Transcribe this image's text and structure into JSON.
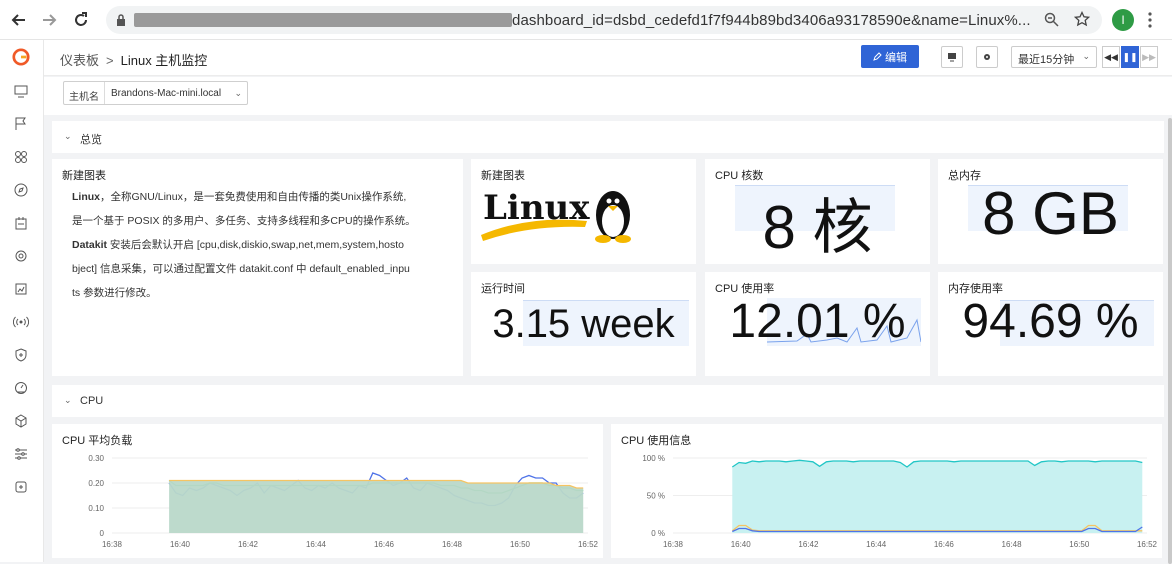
{
  "browser": {
    "url": "dashboard_id=dsbd_cedefd1f7f944b89bd3406a93178590e&name=Linux%...",
    "profile_initial": "I"
  },
  "breadcrumb": {
    "root": "仪表板",
    "separator": ">",
    "current": "Linux 主机监控"
  },
  "toolbar": {
    "edit_label": "编辑",
    "time_range": "最近15分钟"
  },
  "filter": {
    "label": "主机名",
    "value": "Brandons-Mac-mini.local"
  },
  "groups": {
    "overview": "总览",
    "cpu": "CPU"
  },
  "text_card": {
    "title": "新建图表",
    "line1_bold": "Linux",
    "line1_rest": "，全称GNU/Linux，是一套免费使用和自由传播的类Unix操作系统,",
    "line2": "是一个基于 POSIX 的多用户、多任务、支持多线程和多CPU的操作系统。",
    "line3_bold": "Datakit",
    "line3_rest": " 安装后会默认开启 [cpu,disk,diskio,swap,net,mem,system,hosto",
    "line4": "bject] 信息采集，可以通过配置文件 datakit.conf 中 default_enabled_inpu",
    "line5": "ts 参数进行修改。"
  },
  "image_card": {
    "title": "新建图表",
    "logo_text": "Linux"
  },
  "stats": {
    "cpu_cores": {
      "title": "CPU 核数",
      "value": "8 核"
    },
    "memory": {
      "title": "总内存",
      "value": "8 GB"
    },
    "uptime": {
      "title": "运行时间",
      "value": "3.15 week"
    },
    "cpu_usage": {
      "title": "CPU 使用率",
      "value": "12.01 %"
    },
    "mem_usage": {
      "title": "内存使用率",
      "value": "94.69 %"
    }
  },
  "charts": {
    "load": {
      "title": "CPU 平均负载"
    },
    "usage": {
      "title": "CPU 使用信息"
    }
  },
  "colors": {
    "primary": "#2f64d6",
    "load1": "#4f73e8",
    "load5": "#3cc16b",
    "load15": "#f5c463",
    "area": "#b9d8c9",
    "usage_main": "#22c6c6"
  },
  "chart_data": [
    {
      "type": "line",
      "title": "CPU 平均负载",
      "x_ticks": [
        "16:38",
        "16:40",
        "16:42",
        "16:44",
        "16:46",
        "16:48",
        "16:50",
        "16:52"
      ],
      "y_ticks": [
        "0",
        "0.10",
        "0.20",
        "0.30"
      ],
      "ylim": [
        0,
        0.3
      ],
      "x_start_min": 0,
      "x_end_min": 15,
      "series": [
        {
          "values": [
            0.2,
            0.16,
            0.15,
            0.18,
            0.17,
            0.18,
            0.2,
            0.19,
            0.18,
            0.17,
            0.15,
            0.17,
            0.18,
            0.2,
            0.16,
            0.19,
            0.18,
            0.17,
            0.19,
            0.21,
            0.18,
            0.17,
            0.19,
            0.18,
            0.2,
            0.18,
            0.17,
            0.16,
            0.19,
            0.18,
            0.24,
            0.23,
            0.21,
            0.19,
            0.2,
            0.22,
            0.18,
            0.17,
            0.2,
            0.19,
            0.18,
            0.17,
            0.15,
            0.14,
            0.13,
            0.12,
            0.12,
            0.11,
            0.11,
            0.12,
            0.14,
            0.19,
            0.22,
            0.23,
            0.22,
            0.22,
            0.2,
            0.2,
            0.16,
            0.14,
            0.14,
            0.16
          ]
        },
        {
          "values": [
            0.21,
            0.19,
            0.19,
            0.19,
            0.19,
            0.19,
            0.2,
            0.2,
            0.19,
            0.19,
            0.19,
            0.19,
            0.19,
            0.19,
            0.19,
            0.19,
            0.19,
            0.19,
            0.19,
            0.19,
            0.19,
            0.19,
            0.19,
            0.19,
            0.19,
            0.19,
            0.19,
            0.19,
            0.19,
            0.19,
            0.2,
            0.2,
            0.2,
            0.2,
            0.2,
            0.2,
            0.2,
            0.2,
            0.2,
            0.2,
            0.19,
            0.19,
            0.19,
            0.18,
            0.18,
            0.17,
            0.17,
            0.16,
            0.16,
            0.16,
            0.17,
            0.18,
            0.19,
            0.2,
            0.2,
            0.2,
            0.19,
            0.19,
            0.18,
            0.18,
            0.17,
            0.17
          ]
        },
        {
          "values": [
            0.21,
            0.21,
            0.21,
            0.21,
            0.21,
            0.21,
            0.21,
            0.21,
            0.21,
            0.21,
            0.21,
            0.21,
            0.21,
            0.21,
            0.21,
            0.21,
            0.21,
            0.21,
            0.21,
            0.21,
            0.21,
            0.21,
            0.21,
            0.21,
            0.21,
            0.21,
            0.21,
            0.21,
            0.21,
            0.21,
            0.21,
            0.21,
            0.21,
            0.21,
            0.21,
            0.21,
            0.21,
            0.21,
            0.21,
            0.21,
            0.21,
            0.21,
            0.21,
            0.21,
            0.2,
            0.2,
            0.2,
            0.2,
            0.2,
            0.2,
            0.2,
            0.2,
            0.2,
            0.2,
            0.2,
            0.2,
            0.2,
            0.19,
            0.19,
            0.19,
            0.18,
            0.18
          ]
        }
      ]
    },
    {
      "type": "area",
      "title": "CPU 使用信息",
      "x_ticks": [
        "16:38",
        "16:40",
        "16:42",
        "16:44",
        "16:46",
        "16:48",
        "16:50",
        "16:52"
      ],
      "y_ticks": [
        "0 %",
        "50 %",
        "100 %"
      ],
      "ylim": [
        0,
        100
      ],
      "series": [
        {
          "values": [
            88,
            94,
            93,
            96,
            95,
            96,
            96,
            96,
            95,
            96,
            97,
            96,
            95,
            89,
            95,
            96,
            96,
            96,
            95,
            96,
            96,
            96,
            96,
            96,
            96,
            94,
            88,
            95,
            96,
            96,
            96,
            96,
            96,
            95,
            96,
            96,
            96,
            96,
            96,
            96,
            96,
            96,
            96,
            96,
            96,
            90,
            95,
            96,
            96,
            95,
            96,
            96,
            96,
            96,
            95,
            96,
            96,
            96,
            96,
            96,
            96,
            94
          ]
        },
        {
          "values": [
            3,
            10,
            10,
            4,
            3,
            3,
            3,
            3,
            3,
            3,
            3,
            3,
            3,
            3,
            3,
            3,
            3,
            3,
            3,
            3,
            3,
            3,
            3,
            3,
            3,
            3,
            3,
            3,
            3,
            3,
            3,
            3,
            3,
            3,
            3,
            3,
            3,
            3,
            3,
            3,
            3,
            3,
            3,
            3,
            3,
            3,
            3,
            3,
            3,
            3,
            3,
            3,
            3,
            10,
            10,
            3,
            3,
            3,
            3,
            3,
            3,
            3
          ]
        },
        {
          "values": [
            2,
            6,
            6,
            3,
            2,
            2,
            2,
            2,
            2,
            2,
            2,
            2,
            2,
            2,
            2,
            2,
            2,
            2,
            2,
            2,
            2,
            2,
            2,
            2,
            2,
            2,
            2,
            2,
            2,
            2,
            2,
            2,
            2,
            2,
            2,
            2,
            2,
            2,
            2,
            2,
            2,
            2,
            2,
            2,
            2,
            2,
            2,
            2,
            2,
            2,
            2,
            2,
            2,
            6,
            6,
            2,
            2,
            2,
            2,
            2,
            2,
            8
          ]
        }
      ]
    }
  ]
}
